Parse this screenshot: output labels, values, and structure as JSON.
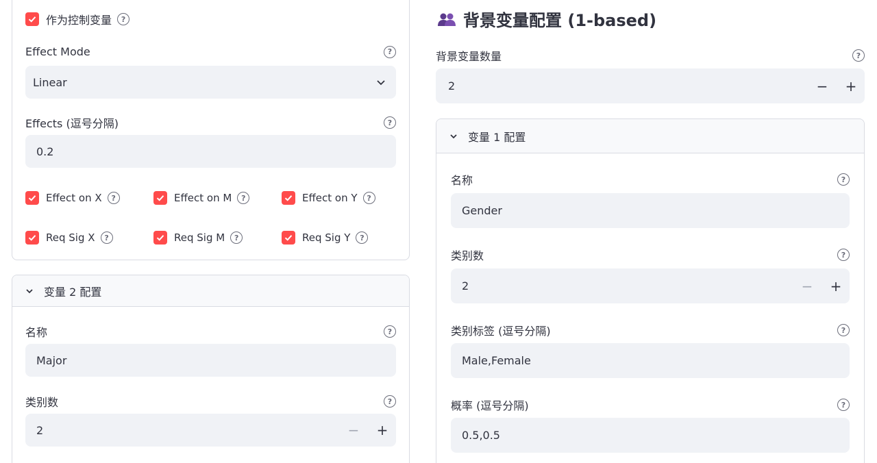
{
  "left": {
    "control_checkbox_label": "作为控制变量",
    "effect_mode": {
      "label": "Effect Mode",
      "value": "Linear"
    },
    "effects": {
      "label": "Effects (逗号分隔)",
      "value": "0.2"
    },
    "checkboxes": [
      {
        "label": "Effect on X"
      },
      {
        "label": "Effect on M"
      },
      {
        "label": "Effect on Y"
      },
      {
        "label": "Req Sig X"
      },
      {
        "label": "Req Sig M"
      },
      {
        "label": "Req Sig Y"
      }
    ],
    "var2": {
      "header": "变量 2 配置",
      "name_label": "名称",
      "name_value": "Major",
      "categories_label": "类别数",
      "categories_value": "2"
    }
  },
  "right": {
    "title": "背景变量配置 (1-based)",
    "count_label": "背景变量数量",
    "count_value": "2",
    "var1": {
      "header": "变量 1 配置",
      "name_label": "名称",
      "name_value": "Gender",
      "categories_label": "类别数",
      "categories_value": "2",
      "cat_labels_label": "类别标签 (逗号分隔)",
      "cat_labels_value": "Male,Female",
      "prob_label": "概率 (逗号分隔)",
      "prob_value": "0.5,0.5"
    }
  },
  "icons": {
    "help": "?",
    "minus": "−",
    "plus": "+"
  },
  "colors": {
    "accent": "#ff4b4b",
    "input_bg": "#f0f2f6",
    "people_icon": "#5b3a8c"
  }
}
